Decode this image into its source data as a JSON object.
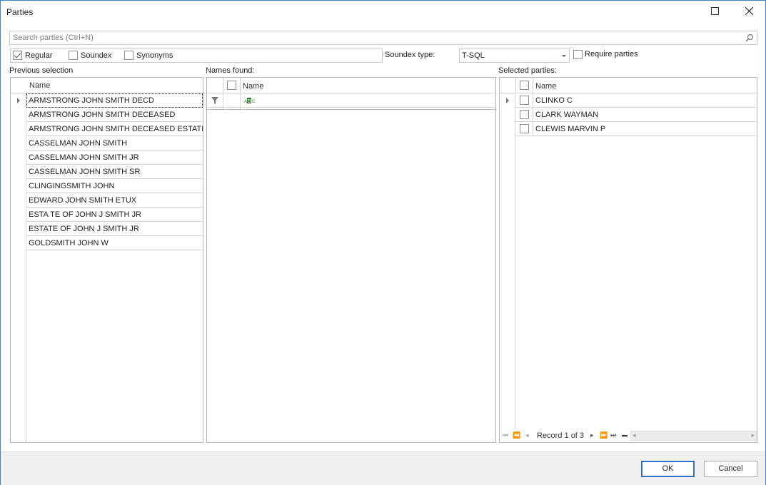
{
  "window": {
    "title": "Parties"
  },
  "search": {
    "placeholder": "Search parties (Ctrl+N)"
  },
  "options": {
    "regular": {
      "label": "Regular",
      "checked": true
    },
    "soundex": {
      "label": "Soundex",
      "checked": false
    },
    "synonyms": {
      "label": "Synonyms",
      "checked": false
    },
    "soundex_type_label": "Soundex type:",
    "soundex_type_value": "T-SQL",
    "require_parties": {
      "label": "Require parties",
      "checked": false
    }
  },
  "previous": {
    "label": "Previous selection",
    "column": "Name",
    "rows": [
      "ARMSTRONG JOHN SMITH DECD",
      "ARMSTRONG JOHN SMITH DECEASED",
      "ARMSTRONG JOHN SMITH DECEASED ESTATE",
      "CASSELMAN JOHN SMITH",
      "CASSELMAN JOHN SMITH JR",
      "CASSELMAN JOHN SMITH SR",
      "CLINGINGSMITH JOHN",
      "EDWARD JOHN SMITH ETUX",
      "ESTA TE OF JOHN J SMITH JR",
      "ESTATE OF JOHN J SMITH JR",
      "GOLDSMITH JOHN W"
    ]
  },
  "names_found": {
    "label": "Names found:",
    "column": "Name",
    "filter_icon": "filter-icon",
    "abc_icon": "text-filter-icon"
  },
  "selected": {
    "label": "Selected parties:",
    "column": "Name",
    "rows": [
      "CLINKO C",
      "CLARK WAYMAN",
      "CLEWIS MARVIN P"
    ],
    "record_text": "Record 1 of 3"
  },
  "buttons": {
    "ok": "OK",
    "cancel": "Cancel"
  },
  "colors": {
    "accent": "#2f6fd1",
    "window_border": "#3b82d8"
  }
}
